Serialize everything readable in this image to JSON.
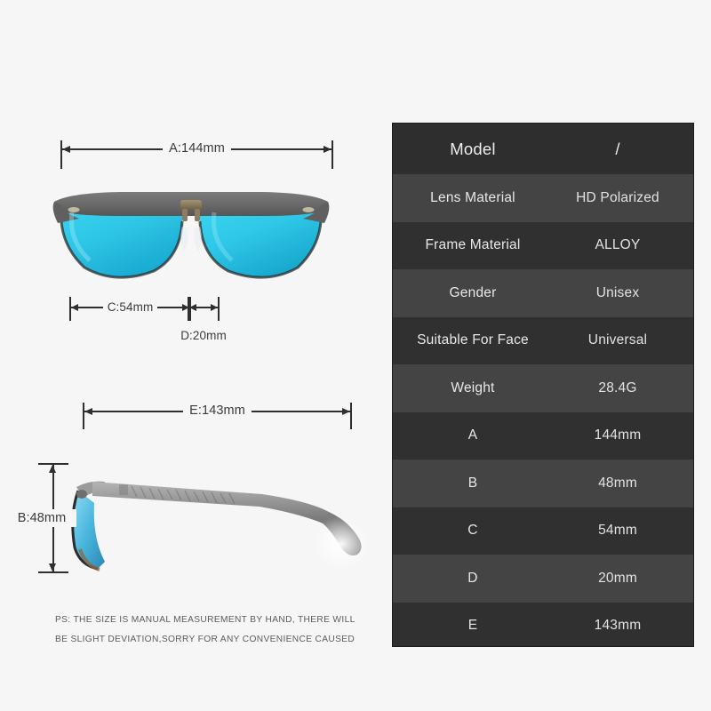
{
  "background_color": "#f6f6f6",
  "diagram": {
    "front_view": {
      "icon": "sunglasses-front-view",
      "lens_color": "#34cbe9",
      "frame_color": "#6b6b6b",
      "bridge_color": "#8a7a5e"
    },
    "side_view": {
      "icon": "sunglasses-side-view",
      "lens_color": "#5fc8e8",
      "frame_color": "#8e8e8e"
    },
    "dimensions": {
      "a": "A:144mm",
      "b": "B:48mm",
      "c": "C:54mm",
      "d": "D:20mm",
      "e": "E:143mm"
    }
  },
  "disclaimer": {
    "line1": "PS: THE SIZE IS MANUAL MEASUREMENT BY HAND, THERE WILL",
    "line2": "BE SLIGHT DEVIATION,SORRY FOR ANY CONVENIENCE CAUSED"
  },
  "spec_table": {
    "rows": [
      {
        "label": "Model",
        "value": "/"
      },
      {
        "label": "Lens Material",
        "value": "HD Polarized"
      },
      {
        "label": "Frame Material",
        "value": "ALLOY"
      },
      {
        "label": "Gender",
        "value": "Unisex"
      },
      {
        "label": "Suitable For Face",
        "value": "Universal"
      },
      {
        "label": "Weight",
        "value": "28.4G"
      },
      {
        "label": "A",
        "value": "144mm"
      },
      {
        "label": "B",
        "value": "48mm"
      },
      {
        "label": "C",
        "value": "54mm"
      },
      {
        "label": "D",
        "value": "20mm"
      },
      {
        "label": "E",
        "value": "143mm"
      }
    ]
  }
}
